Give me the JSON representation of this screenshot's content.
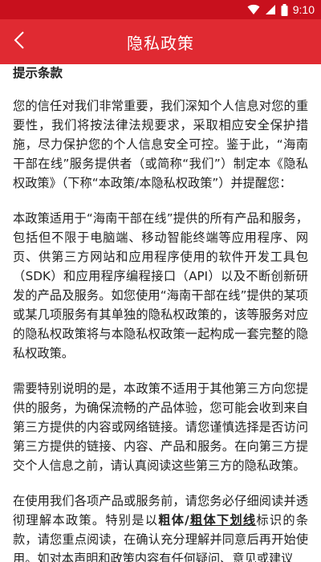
{
  "status_bar": {
    "time": "9:10",
    "bg_color": "#c8101d"
  },
  "app_bar": {
    "title": "隐私政策",
    "back_icon": "chevron-left-icon",
    "bg_color": "#e02a32"
  },
  "content": {
    "heading": "提示条款",
    "paragraphs": [
      "您的信任对我们非常重要，我们深知个人信息对您的重要性，我们将按法律法规要求，采取相应安全保护措施，尽力保护您的个人信息安全可控。鉴于此，“海南干部在线”服务提供者（或简称“我们”）制定本《隐私权政策》（下称“本政策/本隐私权政策”）并提醒您：",
      "本政策适用于“海南干部在线”提供的所有产品和服务，包括但不限于电脑端、移动智能终端等应用程序、网页、供第三方网站和应用程序使用的软件开发工具包（SDK）和应用程序编程接口（API）以及不断创新研发的产品及服务。如您使用“海南干部在线”提供的某项或某几项服务有其单独的隐私权政策的，该等服务对应的隐私权政策将与本隐私权政策一起构成一套完整的隐私权政策。",
      "需要特别说明的是，本政策不适用于其他第三方向您提供的服务，为确保流畅的产品体验，您可能会收到来自第三方提供的内容或网络链接。请您谨慎选择是否访问第三方提供的链接、内容、产品和服务。在向第三方提交个人信息之前，请认真阅读这些第三方的隐私政策。"
    ],
    "last_paragraph": {
      "before": "在使用我们各项产品或服务前，请您务必仔细阅读并透彻理解本政策。特别是以",
      "bold1": "粗体",
      "slash": "/",
      "bold2": "粗体下划线",
      "after": "标识的条款，请您重点阅读，在确认充分理解并同意后再开始使用。如对本声明和政策内容有任何疑问、意见或建议"
    }
  }
}
